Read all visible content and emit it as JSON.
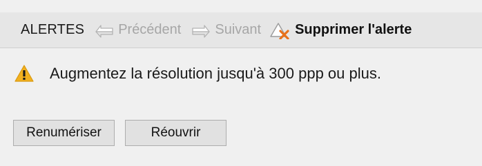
{
  "toolbar": {
    "title": "ALERTES",
    "previous_label": "Précédent",
    "next_label": "Suivant",
    "delete_label": "Supprimer l'alerte"
  },
  "alert": {
    "icon": "warning-icon",
    "message": "Augmentez la résolution jusqu'à 300 ppp ou plus."
  },
  "actions": {
    "rescan_label": "Renumériser",
    "reopen_label": "Réouvrir"
  },
  "colors": {
    "toolbar_bg": "#e6e6e6",
    "background": "#f0f0f0",
    "disabled_text": "#a6a6a6",
    "warning_yellow": "#f2b01e",
    "delete_x_orange": "#e8711a"
  }
}
